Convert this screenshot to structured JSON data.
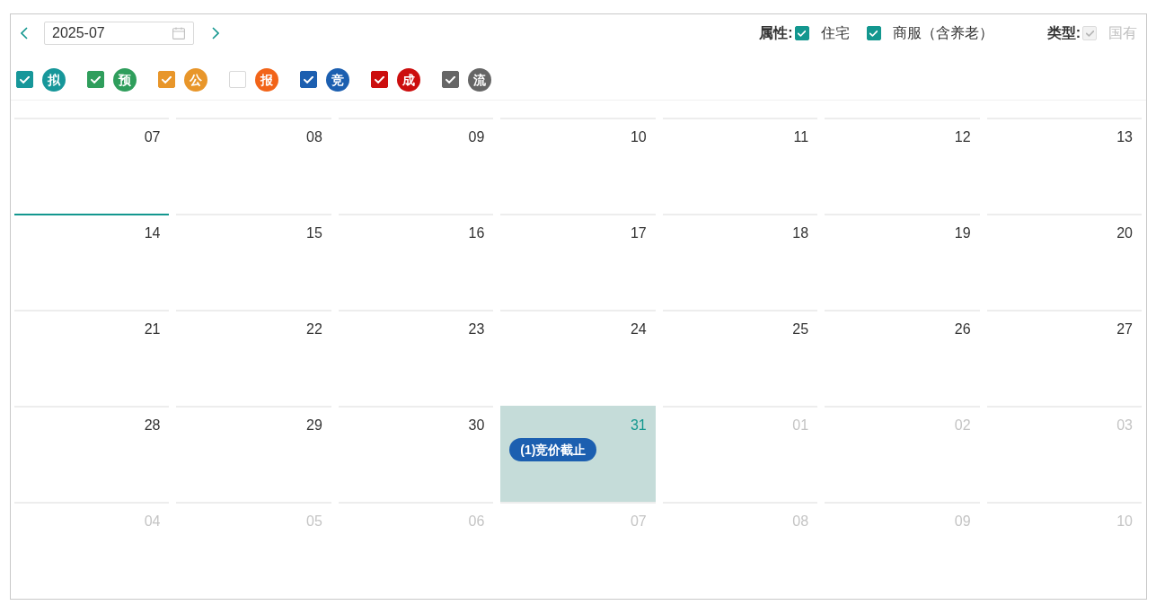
{
  "toolbar": {
    "month_picker": {
      "value": "2025-07"
    },
    "attributes": {
      "label": "属性:",
      "options": [
        {
          "label": "住宅",
          "checked": true,
          "disabled": false
        },
        {
          "label": "商服（含养老）",
          "checked": true,
          "disabled": false
        }
      ]
    },
    "type": {
      "label": "类型:",
      "options": [
        {
          "label": "国有",
          "checked": true,
          "disabled": true
        }
      ]
    }
  },
  "status_filters": [
    {
      "label": "拟",
      "checked": true,
      "color": "#17979a"
    },
    {
      "label": "预",
      "checked": true,
      "color": "#2f9e5c"
    },
    {
      "label": "公",
      "checked": true,
      "color": "#e8962a"
    },
    {
      "label": "报",
      "checked": false,
      "color": "#f26419"
    },
    {
      "label": "竞",
      "checked": true,
      "color": "#1c5fb0"
    },
    {
      "label": "成",
      "checked": true,
      "color": "#cc0e0e"
    },
    {
      "label": "流",
      "checked": true,
      "color": "#666666"
    }
  ],
  "calendar": {
    "weeks": [
      {
        "days": [
          {
            "date": "07",
            "in_month": true,
            "today": false,
            "selected": false
          },
          {
            "date": "08",
            "in_month": true,
            "today": false,
            "selected": false
          },
          {
            "date": "09",
            "in_month": true,
            "today": false,
            "selected": false
          },
          {
            "date": "10",
            "in_month": true,
            "today": false,
            "selected": false
          },
          {
            "date": "11",
            "in_month": true,
            "today": false,
            "selected": false
          },
          {
            "date": "12",
            "in_month": true,
            "today": false,
            "selected": false
          },
          {
            "date": "13",
            "in_month": true,
            "today": false,
            "selected": false
          }
        ]
      },
      {
        "days": [
          {
            "date": "14",
            "in_month": true,
            "today": true,
            "selected": false
          },
          {
            "date": "15",
            "in_month": true,
            "today": false,
            "selected": false
          },
          {
            "date": "16",
            "in_month": true,
            "today": false,
            "selected": false
          },
          {
            "date": "17",
            "in_month": true,
            "today": false,
            "selected": false
          },
          {
            "date": "18",
            "in_month": true,
            "today": false,
            "selected": false
          },
          {
            "date": "19",
            "in_month": true,
            "today": false,
            "selected": false
          },
          {
            "date": "20",
            "in_month": true,
            "today": false,
            "selected": false
          }
        ]
      },
      {
        "days": [
          {
            "date": "21",
            "in_month": true,
            "today": false,
            "selected": false
          },
          {
            "date": "22",
            "in_month": true,
            "today": false,
            "selected": false
          },
          {
            "date": "23",
            "in_month": true,
            "today": false,
            "selected": false
          },
          {
            "date": "24",
            "in_month": true,
            "today": false,
            "selected": false
          },
          {
            "date": "25",
            "in_month": true,
            "today": false,
            "selected": false
          },
          {
            "date": "26",
            "in_month": true,
            "today": false,
            "selected": false
          },
          {
            "date": "27",
            "in_month": true,
            "today": false,
            "selected": false
          }
        ]
      },
      {
        "days": [
          {
            "date": "28",
            "in_month": true,
            "today": false,
            "selected": false
          },
          {
            "date": "29",
            "in_month": true,
            "today": false,
            "selected": false
          },
          {
            "date": "30",
            "in_month": true,
            "today": false,
            "selected": false
          },
          {
            "date": "31",
            "in_month": true,
            "today": false,
            "selected": true,
            "events": [
              {
                "label": "(1)竞价截止",
                "color": "#1c5fb0"
              }
            ]
          },
          {
            "date": "01",
            "in_month": false,
            "today": false,
            "selected": false
          },
          {
            "date": "02",
            "in_month": false,
            "today": false,
            "selected": false
          },
          {
            "date": "03",
            "in_month": false,
            "today": false,
            "selected": false
          }
        ]
      },
      {
        "days": [
          {
            "date": "04",
            "in_month": false,
            "today": false,
            "selected": false
          },
          {
            "date": "05",
            "in_month": false,
            "today": false,
            "selected": false
          },
          {
            "date": "06",
            "in_month": false,
            "today": false,
            "selected": false
          },
          {
            "date": "07",
            "in_month": false,
            "today": false,
            "selected": false
          },
          {
            "date": "08",
            "in_month": false,
            "today": false,
            "selected": false
          },
          {
            "date": "09",
            "in_month": false,
            "today": false,
            "selected": false
          },
          {
            "date": "10",
            "in_month": false,
            "today": false,
            "selected": false
          }
        ]
      }
    ]
  }
}
